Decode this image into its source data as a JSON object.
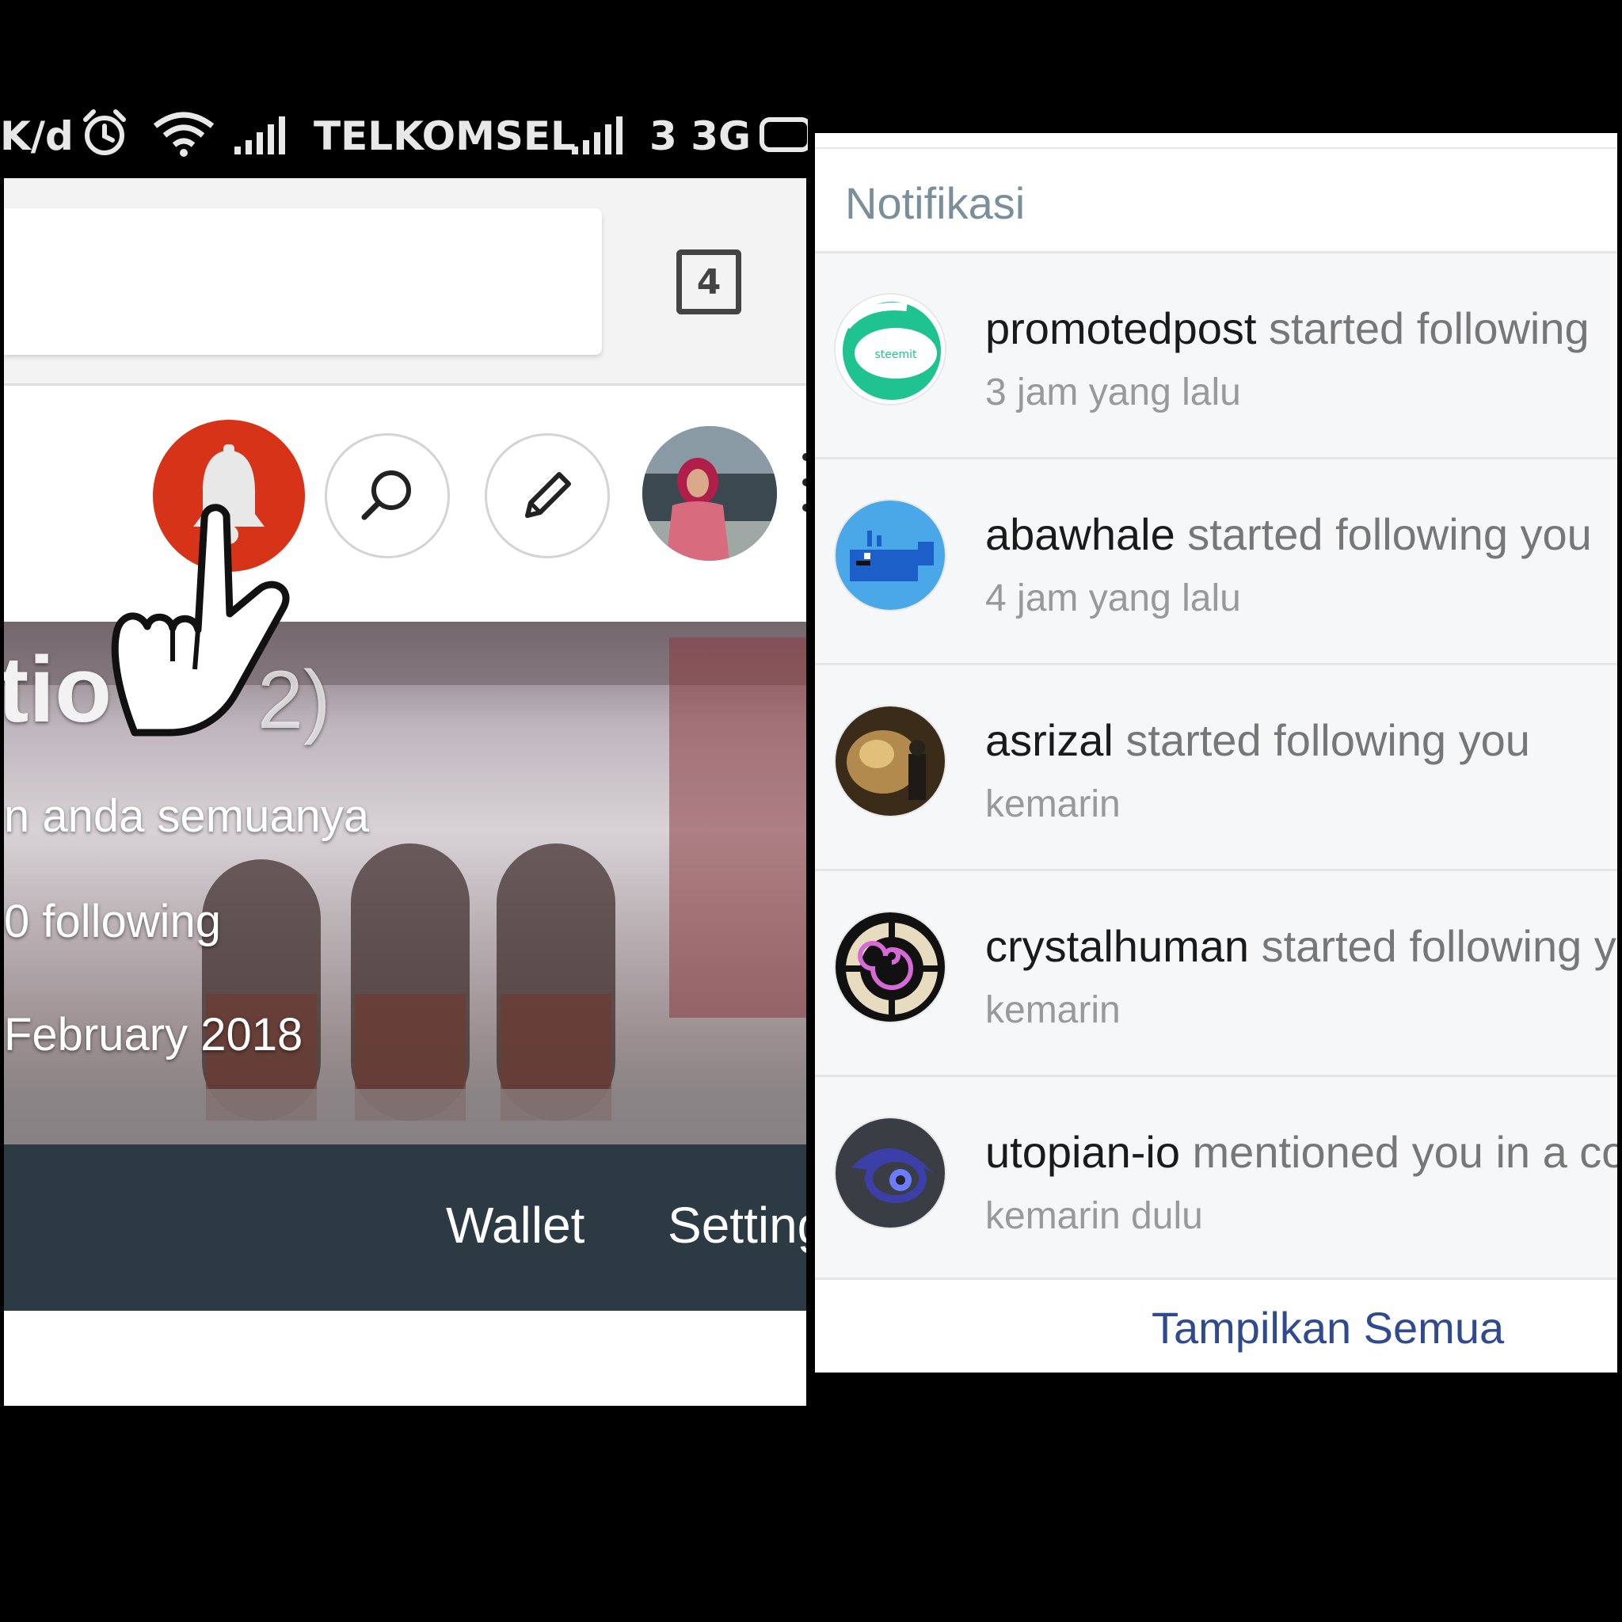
{
  "status_bar": {
    "speed": "K/d",
    "carrier": "TELKOMSEL",
    "network": "3 3G",
    "icons": [
      "alarm-icon",
      "wifi-icon",
      "signal-icon",
      "signal-icon",
      "battery-icon"
    ]
  },
  "browser": {
    "tab_count": "4"
  },
  "profile": {
    "name_fragment": "tio",
    "reputation_fragment": "2)",
    "about_fragment": "n anda semuanya",
    "following_fragment": "0 following",
    "joined_fragment": "February 2018",
    "tabs": [
      "Wallet",
      "Setting"
    ]
  },
  "header_actions": [
    "bell-icon",
    "search-icon",
    "edit-icon",
    "avatar"
  ],
  "colors": {
    "bell_bg": "#d63318",
    "tab_bar_bg": "#2b3a43",
    "link_blue": "#2f4a8f",
    "title_grey": "#7a8f99"
  },
  "notifications": {
    "title": "Notifikasi",
    "items": [
      {
        "user": "promotedpost",
        "action": " started following",
        "time": "3 jam yang lalu",
        "avatar": "steemit-logo-avatar"
      },
      {
        "user": "abawhale",
        "action": " started following you",
        "time": "4 jam yang lalu",
        "avatar": "whale-avatar"
      },
      {
        "user": "asrizal",
        "action": " started following you",
        "time": "kemarin",
        "avatar": "photo-avatar"
      },
      {
        "user": "crystalhuman",
        "action": " started following y",
        "time": "kemarin",
        "avatar": "mandala-avatar"
      },
      {
        "user": "utopian-io",
        "action": " mentioned you in a co",
        "time": "kemarin dulu",
        "avatar": "utopian-eye-avatar"
      }
    ],
    "show_all": "Tampilkan Semua"
  }
}
